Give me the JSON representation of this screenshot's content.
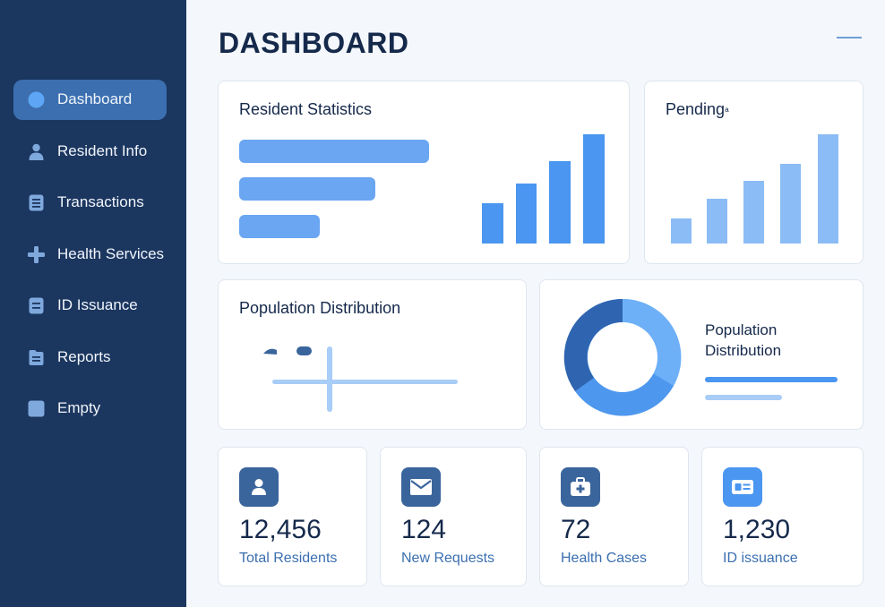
{
  "sidebar": {
    "items": [
      {
        "label": "Dashboard",
        "icon": "circle-icon",
        "active": true
      },
      {
        "label": "Resident Info",
        "icon": "user-icon"
      },
      {
        "label": "Transactions",
        "icon": "document-icon"
      },
      {
        "label": "Health Services",
        "icon": "plus-icon"
      },
      {
        "label": "ID Issuance",
        "icon": "document-icon"
      },
      {
        "label": "Reports",
        "icon": "folder-icon"
      },
      {
        "label": "Empty",
        "icon": "square-icon"
      }
    ]
  },
  "header": {
    "title": "DASHBOARD"
  },
  "cards": {
    "resident_statistics": {
      "title": "Resident Statistics"
    },
    "pending": {
      "title": "Pending",
      "suffix": "ᵃ"
    },
    "population_distribution": {
      "title": "Population Distribution"
    },
    "donut": {
      "label": "Population Distribution"
    }
  },
  "stats": [
    {
      "value": "12,456",
      "label": "Total Residents",
      "icon": "user-icon"
    },
    {
      "value": "124",
      "label": "New Requests",
      "icon": "mail-icon"
    },
    {
      "value": "72",
      "label": "Health Cases",
      "icon": "medical-bag-icon"
    },
    {
      "value": "1,230",
      "label": "ID issuance",
      "icon": "id-card-icon"
    }
  ],
  "colors": {
    "sidebar": "#1b365f",
    "accent": "#4a96f0",
    "accent_light": "#8cbcf5",
    "dark_blue": "#3a659c",
    "text": "#15294b"
  }
}
